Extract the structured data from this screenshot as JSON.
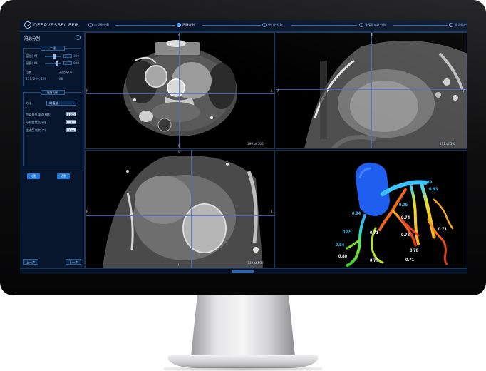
{
  "app": {
    "logo_text": "DEEPVESSEL FFR"
  },
  "steps": [
    {
      "label": "血管树分割",
      "active": false
    },
    {
      "label": "冠脉分割",
      "active": true
    },
    {
      "label": "中心线提取",
      "active": false
    },
    {
      "label": "狭窄段病灶分析",
      "active": false
    },
    {
      "label": "报告输出",
      "active": false
    }
  ],
  "left_panel": {
    "title": "冠脉分割",
    "help": "?",
    "window_group": {
      "title": "二维",
      "rows": [
        {
          "label": "窗位(HU)",
          "value": "300"
        },
        {
          "label": "窗宽(HU)",
          "value": "800"
        }
      ],
      "position_label": "位置",
      "position_value": "179, 209, 130",
      "hu_label": "亮度(HU)",
      "hu_value": "88"
    },
    "seg_group": {
      "title": "冠脉分割",
      "method_label": "方法",
      "method_value": "阈值法",
      "params": [
        {
          "label": "血管最低阈值(HU)",
          "value": "1000"
        },
        {
          "label": "分割置信度下限",
          "value": "6"
        },
        {
          "label": "连通区域数(个)",
          "value": "100"
        }
      ],
      "btn_primary": "分割",
      "btn_secondary": "切割"
    },
    "prev_button": "上一步",
    "next_button": "下一步"
  },
  "viewports": {
    "axial": {
      "top": "A",
      "bottom": "P",
      "left": "R",
      "right": "L",
      "counter": "190 of 306"
    },
    "coronal": {
      "top": "S",
      "bottom": "I",
      "left": "A",
      "right": "P",
      "counter": "292 of 592"
    },
    "sagittal": {
      "top": "S",
      "bottom": "I",
      "left": "R",
      "right": "L",
      "counter": "332 of 592"
    }
  },
  "ffr_labels": [
    "0.89",
    "0.83",
    "0.95",
    "0.94",
    "0.74",
    "0.71",
    "0.85",
    "0.71",
    "0.73",
    "0.84",
    "0.77",
    "0.71",
    "0.80",
    "0.70"
  ],
  "colors": {
    "accent": "#1f7de0",
    "panel": "#07162c",
    "crosshair": "#4a6ee6"
  }
}
